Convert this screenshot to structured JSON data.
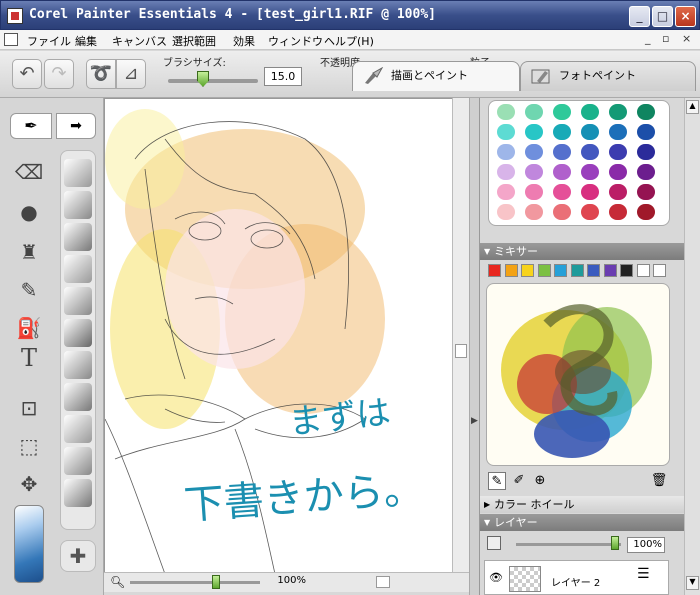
{
  "window": {
    "title": "Corel Painter Essentials 4 - [test_girl1.RIF @ 100%]",
    "controls": {
      "minimize": "_",
      "maximize": "□",
      "close": "×"
    }
  },
  "menu": {
    "items": [
      "ファイル",
      "編集",
      "キャンバス",
      "選択範囲",
      "効果",
      "ウィンドウ",
      "ヘルプ(H)"
    ],
    "mdi_controls": [
      "_",
      "▫",
      "×"
    ]
  },
  "toolbar": {
    "brush_size_label": "ブラシサイズ:",
    "brush_size_value": "15.0",
    "opacity_label": "不透明度:",
    "grain_label": "粒子:"
  },
  "tabs": {
    "draw": "描画とペイント",
    "photo": "フォトペイント"
  },
  "canvas": {
    "handwritten_text_line1": "まずは",
    "handwritten_text_line2": "下書きから。"
  },
  "status": {
    "zoom": "100%"
  },
  "panels": {
    "mixer": "ミキサー",
    "color_wheel": "カラー ホイール",
    "layers": "レイヤー",
    "layer_opacity": "100%",
    "layer_name": "レイヤー 2"
  },
  "colors": {
    "mini_swatches": [
      "#e8271f",
      "#f3a214",
      "#f7d31c",
      "#7bc043",
      "#26a0d8",
      "#1e9b9b",
      "#3a5bbf",
      "#6a3db0",
      "#222222",
      "#ffffff",
      "#ffffff"
    ],
    "swatch_grid": [
      [
        "#9adfb4",
        "#6fd6b0",
        "#2fc99a",
        "#19b28b",
        "#149a75",
        "#0f8560"
      ],
      [
        "#5ddbd3",
        "#28c6c6",
        "#18aab7",
        "#1590b5",
        "#1c6fb9",
        "#1c4fa9"
      ],
      [
        "#9eb6e9",
        "#6f8fdd",
        "#5570cd",
        "#4357bf",
        "#3c3caf",
        "#2b2b9a"
      ],
      [
        "#d8b4e9",
        "#c087dd",
        "#b060cc",
        "#9a3fbd",
        "#8a2aa8",
        "#6c1e8e"
      ],
      [
        "#f4a6c9",
        "#ee7cb1",
        "#e55098",
        "#d82f80",
        "#bb1e66",
        "#951452"
      ],
      [
        "#f8c4c8",
        "#f1989f",
        "#ea6f77",
        "#df4550",
        "#c62a37",
        "#a0192a"
      ]
    ]
  }
}
